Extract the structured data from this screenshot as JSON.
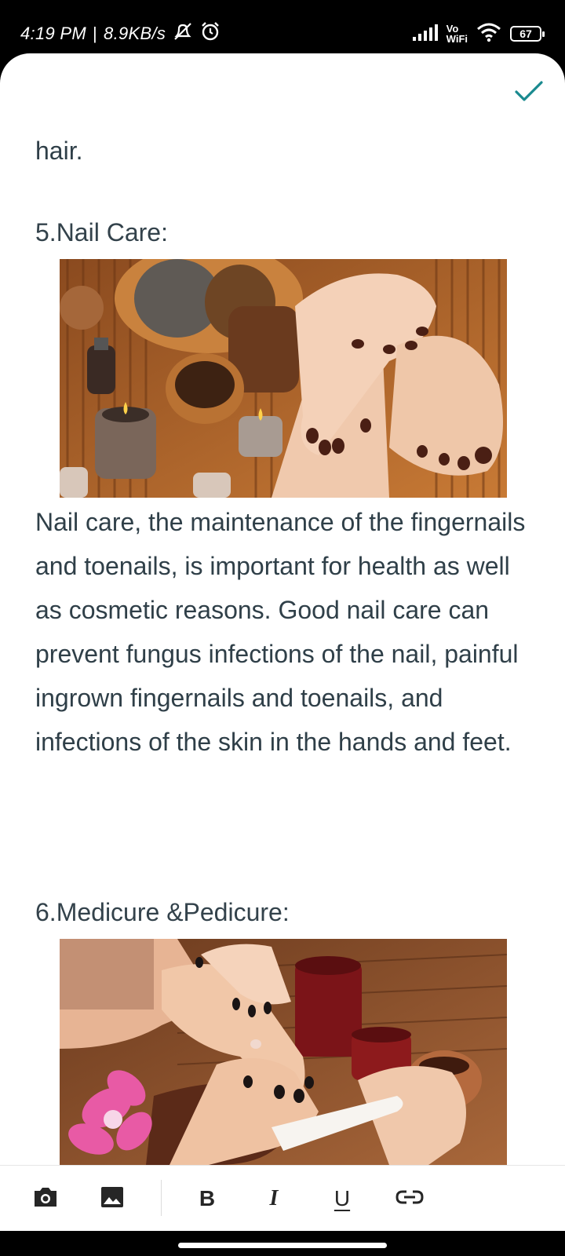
{
  "status_bar": {
    "time": "4:19 PM",
    "separator": "|",
    "speed": "8.9KB/s",
    "vo_label": "Vo",
    "wifi_label": "WiFi",
    "battery": "67"
  },
  "note": {
    "intro_text": "hair.",
    "section5": {
      "heading": "5.Nail Care:",
      "body": "Nail care, the maintenance of the fingernails and toenails, is important for health as well as cosmetic reasons. Good nail care can prevent fungus infections of the nail, painful ingrown fingernails and toenails, and infections of the skin in the hands and feet."
    },
    "section6": {
      "heading": "6.Medicure &Pedicure:"
    }
  },
  "toolbar": {
    "camera_icon": "camera-icon",
    "image_icon": "image-icon",
    "bold_label": "B",
    "italic_label": "I",
    "underline_label": "U",
    "link_icon": "link-icon"
  },
  "colors": {
    "accent": "#1a8a8f",
    "text": "#2f3f48",
    "background": "#ffffff"
  }
}
